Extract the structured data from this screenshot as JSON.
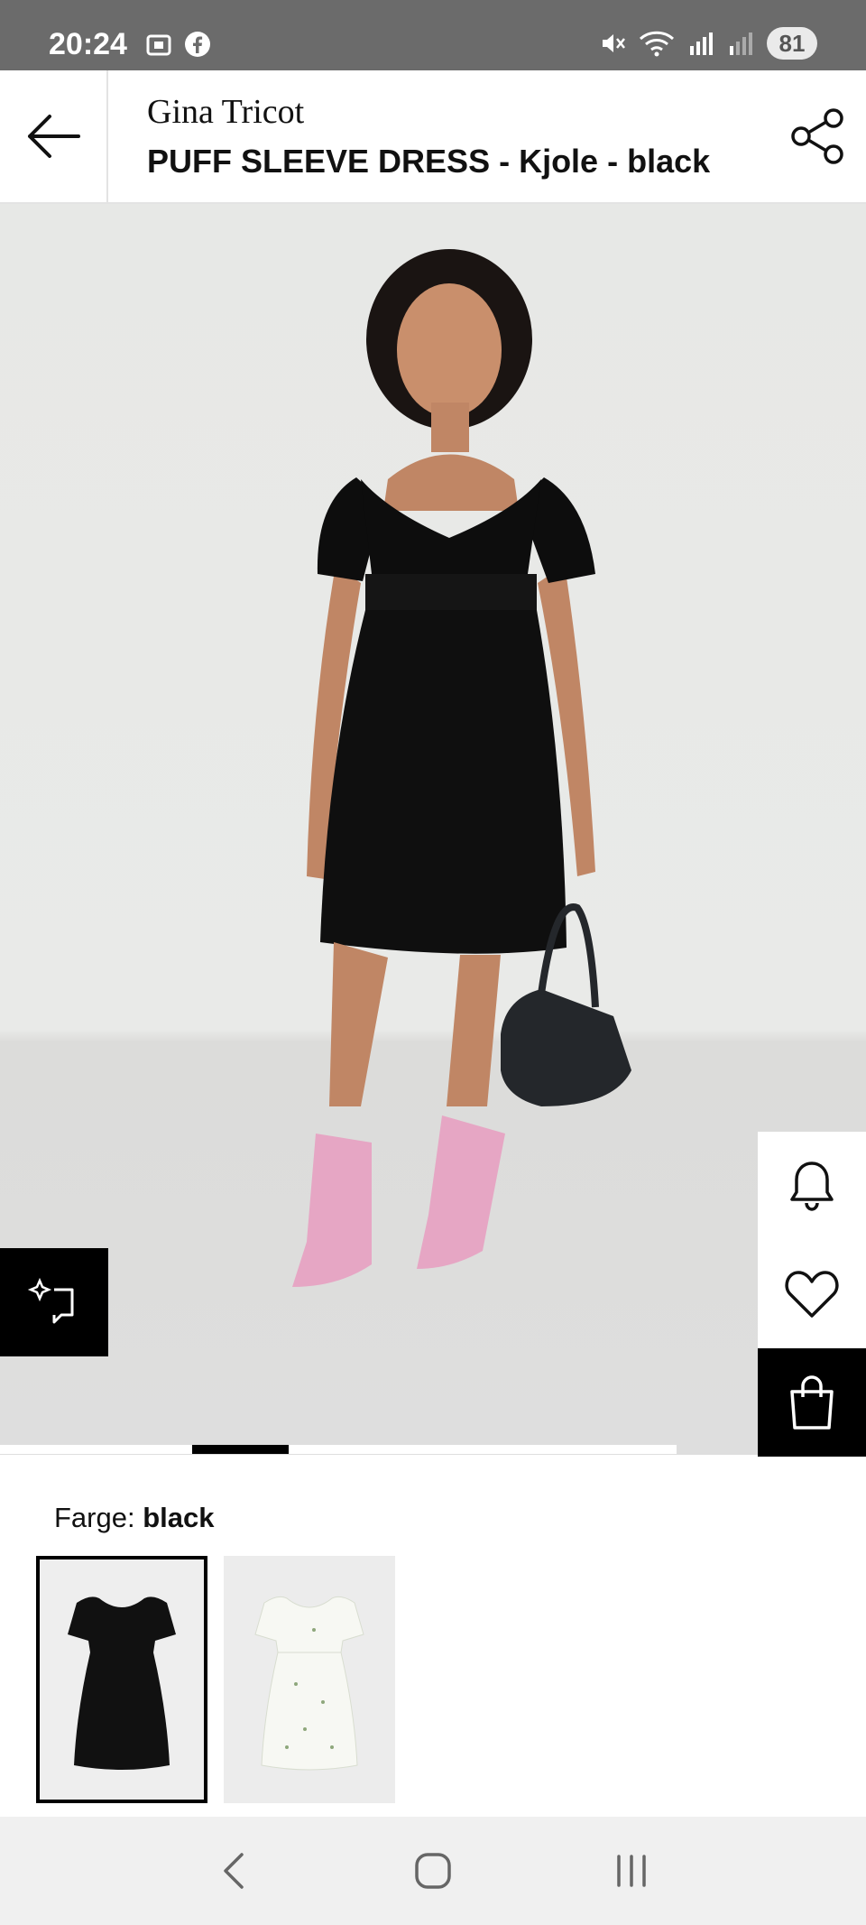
{
  "status_bar": {
    "time": "20:24",
    "battery": "81",
    "left_icons": [
      "screenshot-icon",
      "facebook-icon"
    ],
    "right_icons": [
      "mute-icon",
      "wifi-icon",
      "signal-icon",
      "signal-weak-icon"
    ]
  },
  "header": {
    "brand": "Gina Tricot",
    "title": "PUFF SLEEVE DRESS - Kjole - black",
    "back_icon": "arrow-left-icon",
    "share_icon": "share-icon"
  },
  "gallery": {
    "active_index": 2,
    "side_actions": [
      "bell-icon",
      "heart-icon",
      "shopping-bag-icon"
    ],
    "zoom_icon": "zoom-sparkle-icon"
  },
  "color": {
    "label": "Farge:",
    "value": "black",
    "swatches": [
      {
        "name": "black",
        "selected": true
      },
      {
        "name": "white-floral",
        "selected": false
      }
    ]
  },
  "nav": {
    "icons": [
      "nav-back-icon",
      "home-icon",
      "recents-icon"
    ]
  },
  "colors": {
    "status_bar_bg": "#6b6b6b",
    "accent": "#000000",
    "boot_pink": "#e6a6c4"
  }
}
